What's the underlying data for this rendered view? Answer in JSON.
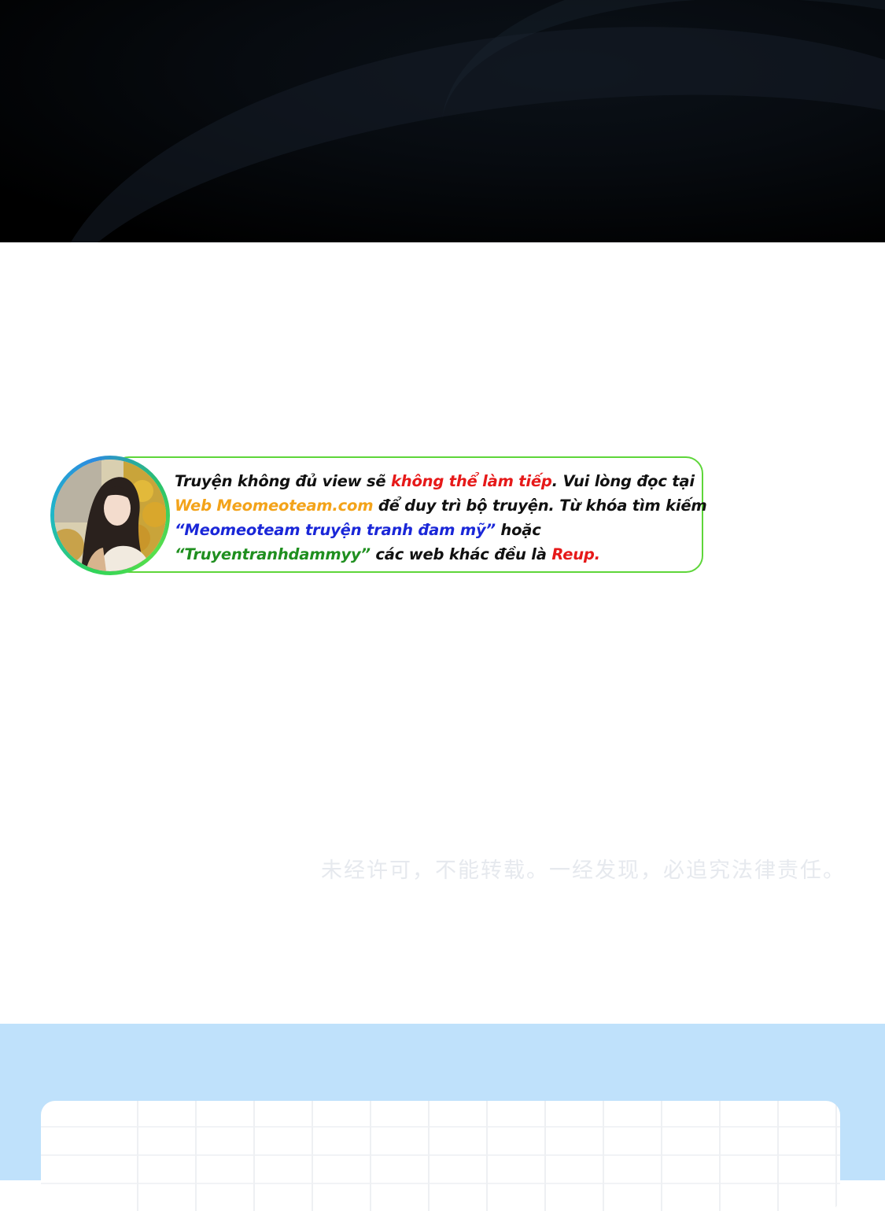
{
  "notice": {
    "line1_a": "Truyện không đủ view sẽ ",
    "line1_b": "không thể làm tiếp",
    "line1_c": ". Vui lòng đọc tại",
    "line2_a": "Web Meomeoteam.com",
    "line2_b": " để duy trì bộ truyện. Từ khóa tìm kiếm",
    "line3_a": "“Meomeoteam truyện tranh đam mỹ”",
    "line3_b": " hoặc",
    "line4_a": "“Truyentranhdammyy”",
    "line4_b": " các web khác đều là ",
    "line4_c": "Reup."
  },
  "watermark": "未经许可，不能转载。一经发现，必追究法律责任。",
  "colors": {
    "accent_red": "#e61919",
    "accent_orange": "#f3a31a",
    "accent_blue": "#1a27d8",
    "accent_green": "#1f8f1f",
    "card_border": "#5ed63a",
    "band_blue": "#bfe1fb"
  },
  "icons": {
    "avatar": "girl-portrait-avatar"
  }
}
